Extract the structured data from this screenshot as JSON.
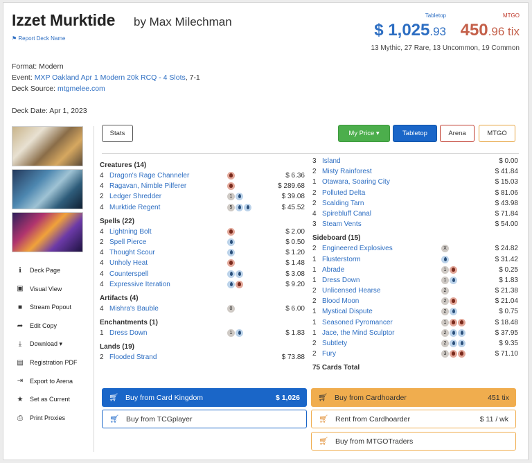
{
  "header": {
    "deck_name": "Izzet Murktide",
    "author": "by Max Milechman",
    "report_link": "Report Deck Name",
    "tabletop_label": "Tabletop",
    "mtgo_label": "MTGO",
    "usd_main": "$ 1,025",
    "usd_cents": ".93",
    "tix_main": "450",
    "tix_cents": ".96 tix",
    "rarity_summary": "13 Mythic, 27 Rare, 13 Uncommon, 19 Common"
  },
  "meta": {
    "format": "Format: Modern",
    "event_prefix": "Event: ",
    "event_link": "MXP Oakland Apr 1 Modern 20k RCQ - 4 Slots",
    "event_suffix": ", 7-1",
    "source_prefix": "Deck Source: ",
    "source_link": "mtgmelee.com",
    "date": "Deck Date: Apr 1, 2023"
  },
  "sidebar": [
    {
      "icon": "info-icon",
      "glyph": "ℹ",
      "label": "Deck Page"
    },
    {
      "icon": "image-icon",
      "glyph": "▣",
      "label": "Visual View"
    },
    {
      "icon": "video-icon",
      "glyph": "■",
      "label": "Stream Popout"
    },
    {
      "icon": "share-icon",
      "glyph": "➦",
      "label": "Edit Copy"
    },
    {
      "icon": "download-icon",
      "glyph": "⤓",
      "label": "Download ▾"
    },
    {
      "icon": "file-pdf-icon",
      "glyph": "▤",
      "label": "Registration PDF"
    },
    {
      "icon": "export-icon",
      "glyph": "⇥",
      "label": "Export to Arena"
    },
    {
      "icon": "star-icon",
      "glyph": "★",
      "label": "Set as Current"
    },
    {
      "icon": "print-icon",
      "glyph": "⎙",
      "label": "Print Proxies"
    }
  ],
  "toolbar": {
    "stats": "Stats",
    "my_price": "My Price ▾",
    "tabletop": "Tabletop",
    "arena": "Arena",
    "mtgo": "MTGO"
  },
  "left_column": [
    {
      "section": "Creatures (14)",
      "cards": [
        {
          "qty": "4",
          "name": "Dragon's Rage Channeler",
          "mana": [
            "r"
          ],
          "price": "$ 6.36"
        },
        {
          "qty": "4",
          "name": "Ragavan, Nimble Pilferer",
          "mana": [
            "r"
          ],
          "price": "$ 289.68"
        },
        {
          "qty": "2",
          "name": "Ledger Shredder",
          "mana": [
            "c1",
            "u"
          ],
          "price": "$ 39.08"
        },
        {
          "qty": "4",
          "name": "Murktide Regent",
          "mana": [
            "c5",
            "u",
            "u"
          ],
          "price": "$ 45.52"
        }
      ]
    },
    {
      "section": "Spells (22)",
      "cards": [
        {
          "qty": "4",
          "name": "Lightning Bolt",
          "mana": [
            "r"
          ],
          "price": "$ 2.00"
        },
        {
          "qty": "2",
          "name": "Spell Pierce",
          "mana": [
            "u"
          ],
          "price": "$ 0.50"
        },
        {
          "qty": "4",
          "name": "Thought Scour",
          "mana": [
            "u"
          ],
          "price": "$ 1.20"
        },
        {
          "qty": "4",
          "name": "Unholy Heat",
          "mana": [
            "r"
          ],
          "price": "$ 1.48"
        },
        {
          "qty": "4",
          "name": "Counterspell",
          "mana": [
            "u",
            "u"
          ],
          "price": "$ 3.08"
        },
        {
          "qty": "4",
          "name": "Expressive Iteration",
          "mana": [
            "u",
            "r"
          ],
          "price": "$ 9.20"
        }
      ]
    },
    {
      "section": "Artifacts (4)",
      "cards": [
        {
          "qty": "4",
          "name": "Mishra's Bauble",
          "mana": [
            "c0"
          ],
          "price": "$ 6.00"
        }
      ]
    },
    {
      "section": "Enchantments (1)",
      "cards": [
        {
          "qty": "1",
          "name": "Dress Down",
          "mana": [
            "c1",
            "u"
          ],
          "price": "$ 1.83"
        }
      ]
    },
    {
      "section": "Lands (19)",
      "cards": [
        {
          "qty": "2",
          "name": "Flooded Strand",
          "mana": [],
          "price": "$ 73.88"
        }
      ]
    }
  ],
  "right_column": {
    "lands": [
      {
        "qty": "3",
        "name": "Island",
        "mana": [],
        "price": "$ 0.00"
      },
      {
        "qty": "2",
        "name": "Misty Rainforest",
        "mana": [],
        "price": "$ 41.84"
      },
      {
        "qty": "1",
        "name": "Otawara, Soaring City",
        "mana": [],
        "price": "$ 15.03"
      },
      {
        "qty": "2",
        "name": "Polluted Delta",
        "mana": [],
        "price": "$ 81.06"
      },
      {
        "qty": "2",
        "name": "Scalding Tarn",
        "mana": [],
        "price": "$ 43.98"
      },
      {
        "qty": "4",
        "name": "Spirebluff Canal",
        "mana": [],
        "price": "$ 71.84"
      },
      {
        "qty": "3",
        "name": "Steam Vents",
        "mana": [],
        "price": "$ 54.00"
      }
    ],
    "sideboard_title": "Sideboard (15)",
    "sideboard": [
      {
        "qty": "2",
        "name": "Engineered Explosives",
        "mana": [
          "cX"
        ],
        "price": "$ 24.82"
      },
      {
        "qty": "1",
        "name": "Flusterstorm",
        "mana": [
          "u"
        ],
        "price": "$ 31.42"
      },
      {
        "qty": "1",
        "name": "Abrade",
        "mana": [
          "c1",
          "r"
        ],
        "price": "$ 0.25"
      },
      {
        "qty": "1",
        "name": "Dress Down",
        "mana": [
          "c1",
          "u"
        ],
        "price": "$ 1.83"
      },
      {
        "qty": "2",
        "name": "Unlicensed Hearse",
        "mana": [
          "c2"
        ],
        "price": "$ 21.38"
      },
      {
        "qty": "2",
        "name": "Blood Moon",
        "mana": [
          "c2",
          "r"
        ],
        "price": "$ 21.04"
      },
      {
        "qty": "1",
        "name": "Mystical Dispute",
        "mana": [
          "c2",
          "u"
        ],
        "price": "$ 0.75"
      },
      {
        "qty": "1",
        "name": "Seasoned Pyromancer",
        "mana": [
          "c1",
          "r",
          "r"
        ],
        "price": "$ 18.48"
      },
      {
        "qty": "1",
        "name": "Jace, the Mind Sculptor",
        "mana": [
          "c2",
          "u",
          "u"
        ],
        "price": "$ 37.95"
      },
      {
        "qty": "2",
        "name": "Subtlety",
        "mana": [
          "c2",
          "u",
          "u"
        ],
        "price": "$ 9.35"
      },
      {
        "qty": "2",
        "name": "Fury",
        "mana": [
          "c3",
          "r",
          "r"
        ],
        "price": "$ 71.10"
      }
    ],
    "total": "75 Cards Total"
  },
  "buy": {
    "card_kingdom": "Buy from Card Kingdom",
    "card_kingdom_price": "$ 1,026",
    "tcgplayer": "Buy from TCGplayer",
    "cardhoarder": "Buy from Cardhoarder",
    "cardhoarder_price": "451 tix",
    "rent": "Rent from Cardhoarder",
    "rent_price": "$ 11 / wk",
    "mtgotraders": "Buy from MTGOTraders"
  },
  "colors": {
    "blue_link": "#2d6ec2",
    "btn_green": "#4cae4c",
    "btn_blue": "#1a66c8",
    "arena_border": "#c0392b",
    "mtgo_border": "#e6a23c",
    "cardhoarder_orange": "#f0ad4e"
  }
}
